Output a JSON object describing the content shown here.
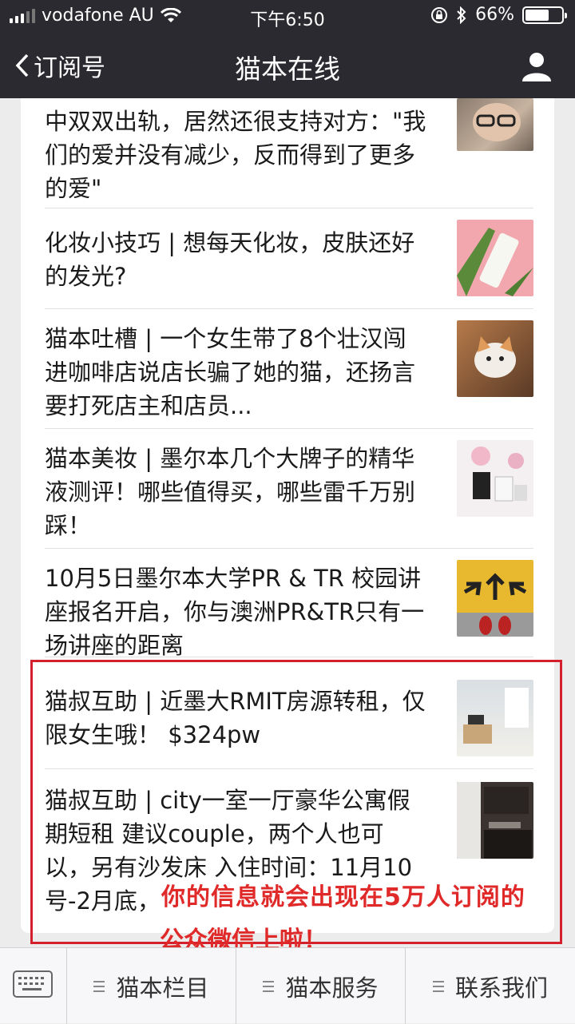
{
  "status": {
    "carrier": "vodafone AU",
    "time": "下午6:50",
    "battery": "66%",
    "battery_level": 0.66
  },
  "nav": {
    "back_label": "订阅号",
    "title": "猫本在线"
  },
  "articles": [
    {
      "title": "中双双出轨，居然还很支持对方：\"我们的爱并没有减少，反而得到了更多的爱\"",
      "thumb": "man-with-glasses"
    },
    {
      "title": "化妆小技巧 | 想每天化妆，皮肤还好的发光?",
      "thumb": "skincare-bottle"
    },
    {
      "title": "猫本吐槽 | 一个女生带了8个壮汉闯进咖啡店说店长骗了她的猫，还扬言要打死店主和店员...",
      "thumb": "cat"
    },
    {
      "title": "猫本美妆 | 墨尔本几个大牌子的精华液测评！哪些值得买，哪些雷千万别踩！",
      "thumb": "serum-products"
    },
    {
      "title": "10月5日墨尔本大学PR & TR 校园讲座报名开启，你与澳洲PR&TR只有一场讲座的距离",
      "thumb": "arrows-road"
    },
    {
      "title": "猫叔互助 | 近墨大RMIT房源转租，仅限女生哦！ $324pw",
      "thumb": "apartment-room"
    },
    {
      "title": "猫叔互助 | city一室一厅豪华公寓假期短租 建议couple，两个人也可以，另有沙发床 入住时间：11月10号-2月底，",
      "thumb": "kitchen"
    }
  ],
  "overlay": {
    "line1": "你的信息就会出现在5万人订阅的",
    "line2": "公众微信上啦！"
  },
  "tabbar": {
    "tabs": [
      {
        "label": "猫本栏目"
      },
      {
        "label": "猫本服务"
      },
      {
        "label": "联系我们"
      }
    ]
  },
  "colors": {
    "nav_bg": "#2b2a30",
    "highlight": "#d4202c"
  }
}
